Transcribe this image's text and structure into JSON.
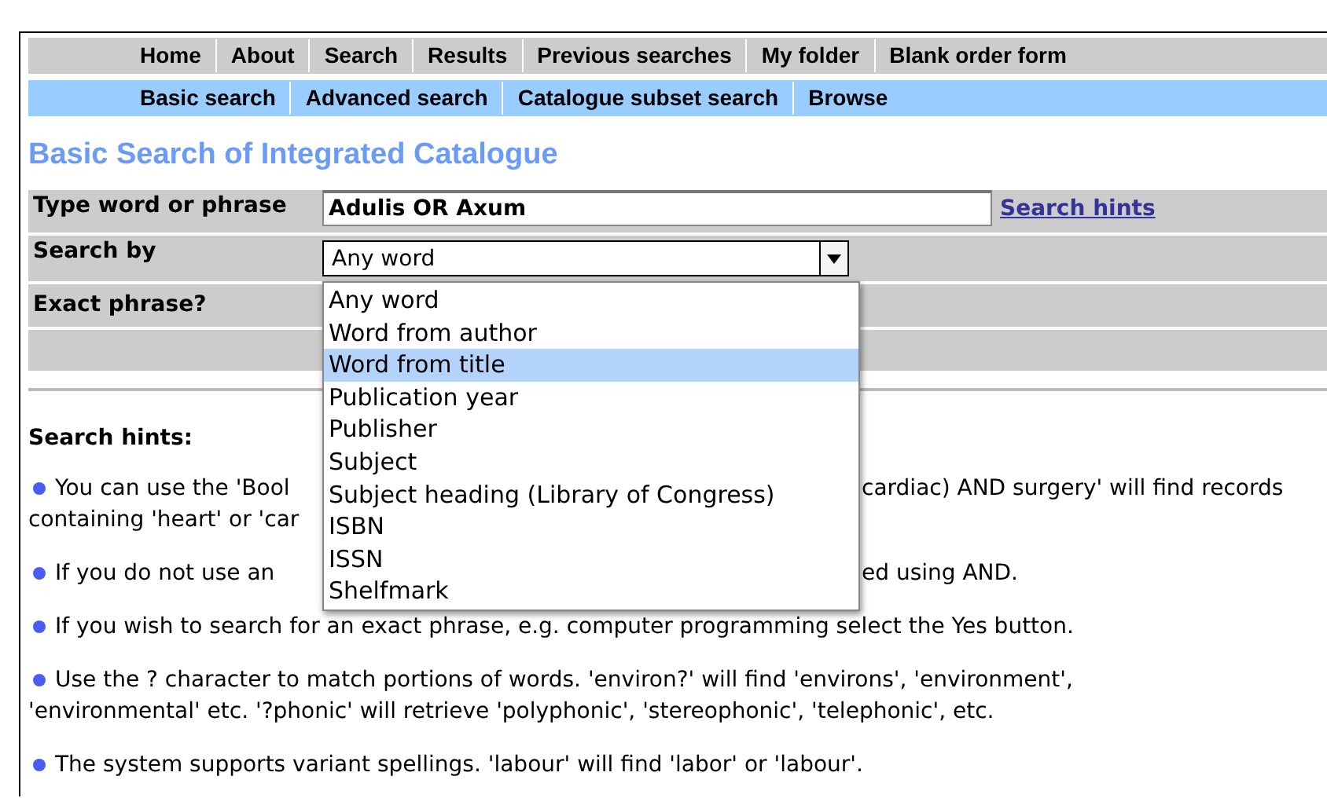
{
  "nav": [
    {
      "label": "Home"
    },
    {
      "label": "About"
    },
    {
      "label": "Search"
    },
    {
      "label": "Results"
    },
    {
      "label": "Previous searches"
    },
    {
      "label": "My folder"
    },
    {
      "label": "Blank order form"
    }
  ],
  "subnav": [
    {
      "label": "Basic search"
    },
    {
      "label": "Advanced search"
    },
    {
      "label": "Catalogue subset search"
    },
    {
      "label": "Browse"
    }
  ],
  "title": "Basic Search of Integrated Catalogue",
  "form": {
    "query_label": "Type word or phrase",
    "query_value": "Adulis OR Axum",
    "hints_link": "Search hints",
    "search_by_label": "Search by",
    "search_by_value": "Any word",
    "exact_label": "Exact phrase?"
  },
  "dropdown": {
    "options": [
      {
        "label": "Any word",
        "selected": false
      },
      {
        "label": "Word from author",
        "selected": false
      },
      {
        "label": "Word from title",
        "selected": true
      },
      {
        "label": "Publication year",
        "selected": false
      },
      {
        "label": "Publisher",
        "selected": false
      },
      {
        "label": "Subject",
        "selected": false
      },
      {
        "label": "Subject heading (Library of Congress)",
        "selected": false
      },
      {
        "label": "ISBN",
        "selected": false
      },
      {
        "label": "ISSN",
        "selected": false
      },
      {
        "label": "Shelfmark",
        "selected": false
      }
    ]
  },
  "hints_heading": "Search hints:",
  "hints": [
    {
      "lines": [
        {
          "left": "You can use the 'Bool",
          "right": "cardiac) AND surgery' will find records"
        },
        {
          "left": "containing 'heart' or 'car"
        }
      ]
    },
    {
      "lines": [
        {
          "left": "If you do not use an",
          "right": "ed using AND."
        }
      ]
    },
    {
      "lines": [
        {
          "left": "If you wish to search for an exact phrase, e.g. computer programming select the Yes button."
        }
      ]
    },
    {
      "lines": [
        {
          "left": "Use the ? character to match portions of words. 'environ?' will find 'environs', 'environment',"
        },
        {
          "left": "'environmental' etc. '?phonic' will retrieve 'polyphonic', 'stereophonic', 'telephonic', etc."
        }
      ]
    },
    {
      "lines": [
        {
          "left": "The system supports variant spellings. 'labour' will find 'labor' or 'labour'."
        }
      ]
    }
  ]
}
